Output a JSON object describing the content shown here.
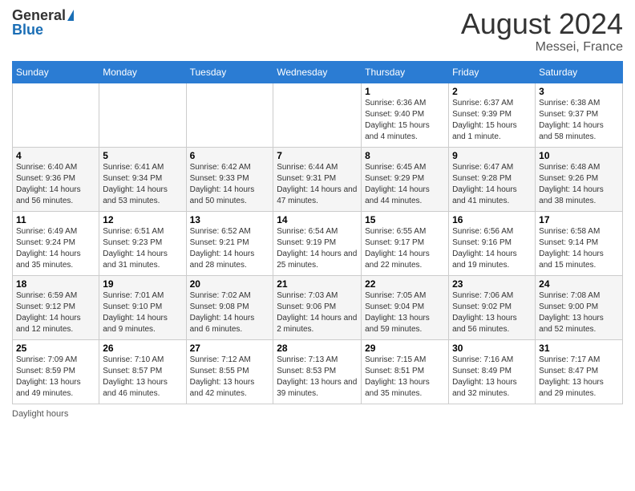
{
  "header": {
    "logo_general": "General",
    "logo_blue": "Blue",
    "month_title": "August 2024",
    "location": "Messei, France"
  },
  "days_of_week": [
    "Sunday",
    "Monday",
    "Tuesday",
    "Wednesday",
    "Thursday",
    "Friday",
    "Saturday"
  ],
  "weeks": [
    [
      {
        "day": "",
        "info": ""
      },
      {
        "day": "",
        "info": ""
      },
      {
        "day": "",
        "info": ""
      },
      {
        "day": "",
        "info": ""
      },
      {
        "day": "1",
        "info": "Sunrise: 6:36 AM\nSunset: 9:40 PM\nDaylight: 15 hours and 4 minutes."
      },
      {
        "day": "2",
        "info": "Sunrise: 6:37 AM\nSunset: 9:39 PM\nDaylight: 15 hours and 1 minute."
      },
      {
        "day": "3",
        "info": "Sunrise: 6:38 AM\nSunset: 9:37 PM\nDaylight: 14 hours and 58 minutes."
      }
    ],
    [
      {
        "day": "4",
        "info": "Sunrise: 6:40 AM\nSunset: 9:36 PM\nDaylight: 14 hours and 56 minutes."
      },
      {
        "day": "5",
        "info": "Sunrise: 6:41 AM\nSunset: 9:34 PM\nDaylight: 14 hours and 53 minutes."
      },
      {
        "day": "6",
        "info": "Sunrise: 6:42 AM\nSunset: 9:33 PM\nDaylight: 14 hours and 50 minutes."
      },
      {
        "day": "7",
        "info": "Sunrise: 6:44 AM\nSunset: 9:31 PM\nDaylight: 14 hours and 47 minutes."
      },
      {
        "day": "8",
        "info": "Sunrise: 6:45 AM\nSunset: 9:29 PM\nDaylight: 14 hours and 44 minutes."
      },
      {
        "day": "9",
        "info": "Sunrise: 6:47 AM\nSunset: 9:28 PM\nDaylight: 14 hours and 41 minutes."
      },
      {
        "day": "10",
        "info": "Sunrise: 6:48 AM\nSunset: 9:26 PM\nDaylight: 14 hours and 38 minutes."
      }
    ],
    [
      {
        "day": "11",
        "info": "Sunrise: 6:49 AM\nSunset: 9:24 PM\nDaylight: 14 hours and 35 minutes."
      },
      {
        "day": "12",
        "info": "Sunrise: 6:51 AM\nSunset: 9:23 PM\nDaylight: 14 hours and 31 minutes."
      },
      {
        "day": "13",
        "info": "Sunrise: 6:52 AM\nSunset: 9:21 PM\nDaylight: 14 hours and 28 minutes."
      },
      {
        "day": "14",
        "info": "Sunrise: 6:54 AM\nSunset: 9:19 PM\nDaylight: 14 hours and 25 minutes."
      },
      {
        "day": "15",
        "info": "Sunrise: 6:55 AM\nSunset: 9:17 PM\nDaylight: 14 hours and 22 minutes."
      },
      {
        "day": "16",
        "info": "Sunrise: 6:56 AM\nSunset: 9:16 PM\nDaylight: 14 hours and 19 minutes."
      },
      {
        "day": "17",
        "info": "Sunrise: 6:58 AM\nSunset: 9:14 PM\nDaylight: 14 hours and 15 minutes."
      }
    ],
    [
      {
        "day": "18",
        "info": "Sunrise: 6:59 AM\nSunset: 9:12 PM\nDaylight: 14 hours and 12 minutes."
      },
      {
        "day": "19",
        "info": "Sunrise: 7:01 AM\nSunset: 9:10 PM\nDaylight: 14 hours and 9 minutes."
      },
      {
        "day": "20",
        "info": "Sunrise: 7:02 AM\nSunset: 9:08 PM\nDaylight: 14 hours and 6 minutes."
      },
      {
        "day": "21",
        "info": "Sunrise: 7:03 AM\nSunset: 9:06 PM\nDaylight: 14 hours and 2 minutes."
      },
      {
        "day": "22",
        "info": "Sunrise: 7:05 AM\nSunset: 9:04 PM\nDaylight: 13 hours and 59 minutes."
      },
      {
        "day": "23",
        "info": "Sunrise: 7:06 AM\nSunset: 9:02 PM\nDaylight: 13 hours and 56 minutes."
      },
      {
        "day": "24",
        "info": "Sunrise: 7:08 AM\nSunset: 9:00 PM\nDaylight: 13 hours and 52 minutes."
      }
    ],
    [
      {
        "day": "25",
        "info": "Sunrise: 7:09 AM\nSunset: 8:59 PM\nDaylight: 13 hours and 49 minutes."
      },
      {
        "day": "26",
        "info": "Sunrise: 7:10 AM\nSunset: 8:57 PM\nDaylight: 13 hours and 46 minutes."
      },
      {
        "day": "27",
        "info": "Sunrise: 7:12 AM\nSunset: 8:55 PM\nDaylight: 13 hours and 42 minutes."
      },
      {
        "day": "28",
        "info": "Sunrise: 7:13 AM\nSunset: 8:53 PM\nDaylight: 13 hours and 39 minutes."
      },
      {
        "day": "29",
        "info": "Sunrise: 7:15 AM\nSunset: 8:51 PM\nDaylight: 13 hours and 35 minutes."
      },
      {
        "day": "30",
        "info": "Sunrise: 7:16 AM\nSunset: 8:49 PM\nDaylight: 13 hours and 32 minutes."
      },
      {
        "day": "31",
        "info": "Sunrise: 7:17 AM\nSunset: 8:47 PM\nDaylight: 13 hours and 29 minutes."
      }
    ]
  ],
  "footer": {
    "daylight_label": "Daylight hours"
  }
}
